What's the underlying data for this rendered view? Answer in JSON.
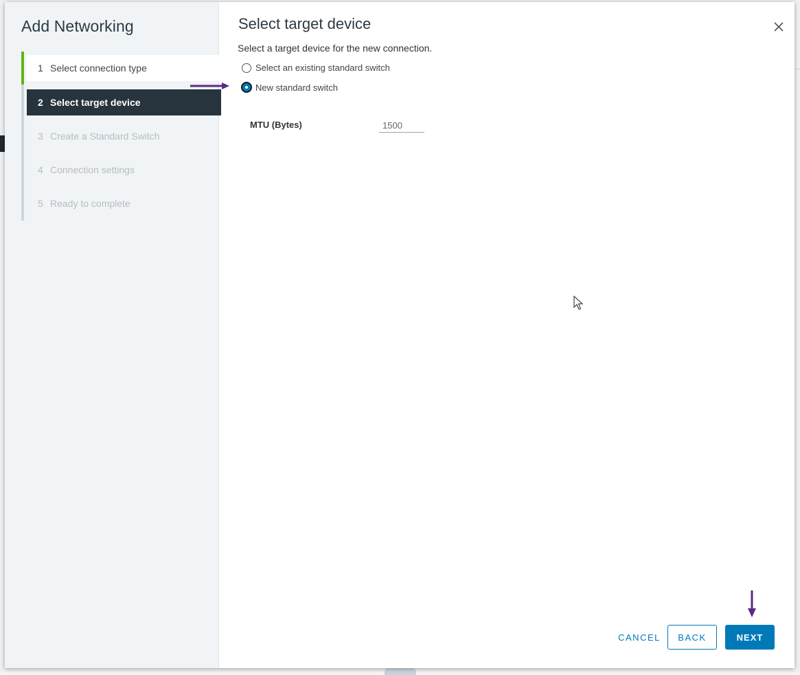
{
  "dialog": {
    "title": "Add Networking",
    "steps": [
      {
        "num": "1",
        "label": "Select connection type",
        "state": "completed"
      },
      {
        "num": "2",
        "label": "Select target device",
        "state": "active"
      },
      {
        "num": "3",
        "label": "Create a Standard Switch",
        "state": "pending"
      },
      {
        "num": "4",
        "label": "Connection settings",
        "state": "pending"
      },
      {
        "num": "5",
        "label": "Ready to complete",
        "state": "pending"
      }
    ]
  },
  "page": {
    "title": "Select target device",
    "subtitle": "Select a target device for the new connection.",
    "options": [
      {
        "label": "Select an existing standard switch",
        "selected": false
      },
      {
        "label": "New standard switch",
        "selected": true
      }
    ],
    "mtu": {
      "label": "MTU (Bytes)",
      "value": "1500"
    }
  },
  "footer": {
    "cancel_label": "CANCEL",
    "back_label": "BACK",
    "next_label": "NEXT"
  },
  "icons": {
    "close": "close-icon",
    "annotation_arrow": "arrow-icon",
    "cursor": "mouse-cursor-icon"
  },
  "colors": {
    "primary": "#0079b8",
    "active_step_bg": "#27343d",
    "completed_accent": "#60b515",
    "annotation_arrow": "#5b2a86"
  }
}
